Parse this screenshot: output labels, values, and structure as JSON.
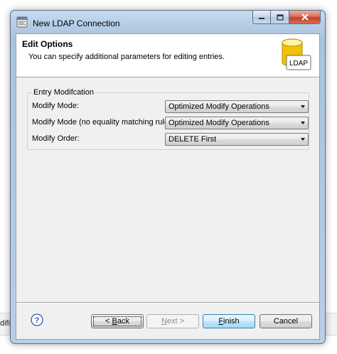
{
  "background": {
    "partial_text": "dificat"
  },
  "window": {
    "title": "New LDAP Connection"
  },
  "header": {
    "title": "Edit Options",
    "description": "You can specify additional parameters for editing entries.",
    "icon_label": "LDAP"
  },
  "group": {
    "legend": "Entry Modifcation",
    "rows": [
      {
        "label": "Modify Mode:",
        "value": "Optimized Modify Operations"
      },
      {
        "label": "Modify Mode (no equality matching rule):",
        "value": "Optimized Modify Operations"
      },
      {
        "label": "Modify Order:",
        "value": "DELETE First"
      }
    ]
  },
  "buttons": {
    "help_glyph": "?",
    "back": {
      "prefix": "< ",
      "mnemonic": "B",
      "rest": "ack"
    },
    "next": {
      "mnemonic": "N",
      "rest": "ext >"
    },
    "finish": {
      "mnemonic": "F",
      "rest": "inish"
    },
    "cancel": "Cancel"
  },
  "colors": {
    "finish_border": "#3c7fb1",
    "ldap_db": "#f2c200"
  }
}
